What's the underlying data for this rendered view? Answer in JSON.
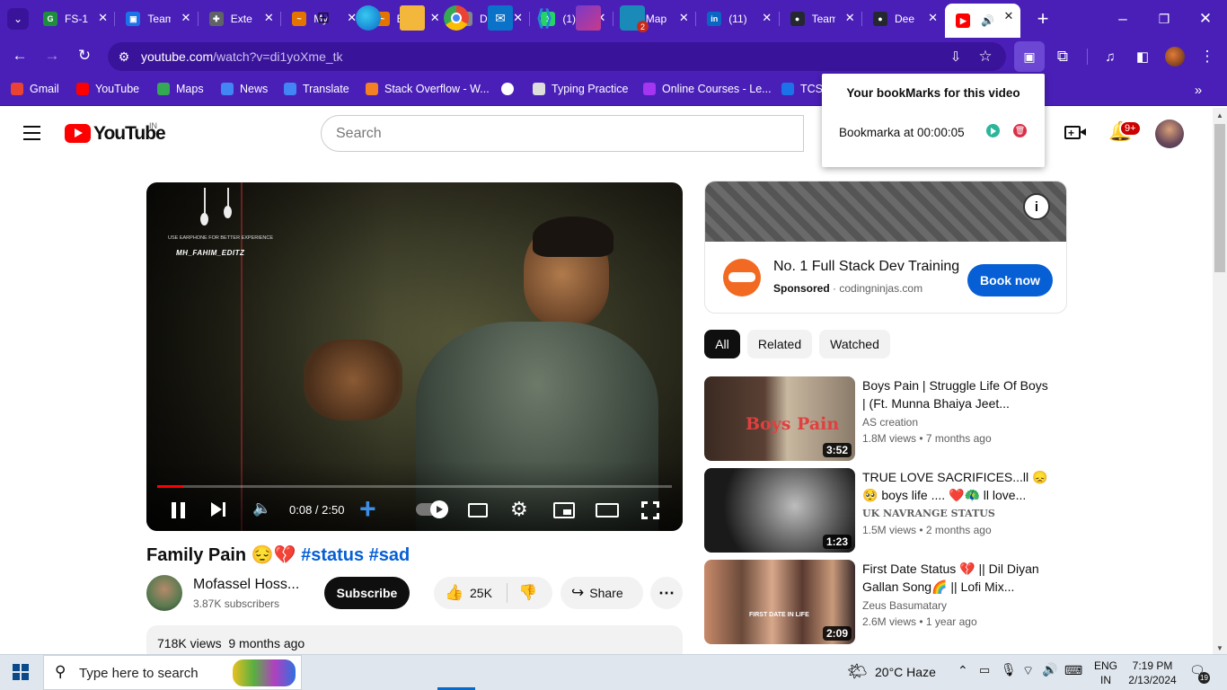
{
  "tabs": [
    {
      "title": "FS-1",
      "color": "#1e8e3e",
      "glyph": "G"
    },
    {
      "title": "Team",
      "color": "#1a73e8",
      "glyph": "▣"
    },
    {
      "title": "Exte",
      "color": "#5f6368",
      "glyph": "✚"
    },
    {
      "title": "My",
      "color": "#e37400",
      "glyph": "~"
    },
    {
      "title": "Butt",
      "color": "#e37400",
      "glyph": "~"
    },
    {
      "title": "Doc",
      "color": "#80868b",
      "glyph": "◐"
    },
    {
      "title": "(1) W",
      "color": "#25d366",
      "glyph": "1"
    },
    {
      "title": "Map",
      "color": "#000000",
      "glyph": "DEV"
    },
    {
      "title": "(11)",
      "color": "#0a66c2",
      "glyph": "in"
    },
    {
      "title": "Team",
      "color": "#24292f",
      "glyph": "●"
    },
    {
      "title": "Dee",
      "color": "#24292f",
      "glyph": "●"
    },
    {
      "title": "",
      "color": "#ff0000",
      "glyph": "▶"
    }
  ],
  "address": {
    "domain": "youtube.com",
    "path": "/watch?v=di1yoXme_tk"
  },
  "bookmarks": [
    {
      "label": "Gmail",
      "color": "#ea4335"
    },
    {
      "label": "YouTube",
      "color": "#ff0000"
    },
    {
      "label": "Maps",
      "color": "#34a853"
    },
    {
      "label": "News",
      "color": "#4285f4"
    },
    {
      "label": "Translate",
      "color": "#4285f4"
    },
    {
      "label": "Stack Overflow - W...",
      "color": "#f48024"
    },
    {
      "label": "",
      "color": "#ffffff"
    },
    {
      "label": "Typing Practice",
      "color": "#dddddd"
    },
    {
      "label": "Online Courses - Le...",
      "color": "#a435f0"
    },
    {
      "label": "TCS",
      "color": "#1a73e8"
    }
  ],
  "popup": {
    "title": "Your bookMarks for this video",
    "items": [
      {
        "label": "Bookmarka at 00:00:05"
      }
    ]
  },
  "yt": {
    "logo": "YouTube",
    "region": "IN",
    "search_placeholder": "Search",
    "notif_count": "9+"
  },
  "player": {
    "watermark_small": "USE EARPHONE FOR BETTER EXPERIENCE",
    "watermark": "MH_FAHIM_EDITZ",
    "time": "0:08 / 2:50",
    "progress": 0.05
  },
  "video": {
    "title": "Family Pain 😔💔",
    "hashtags": "#status #sad",
    "channel": "Mofassel Hoss...",
    "subscribers": "3.87K subscribers",
    "subscribe_label": "Subscribe",
    "likes": "25K",
    "share_label": "Share",
    "views": "718K views",
    "date": "9 months ago"
  },
  "ad": {
    "title": "No. 1 Full Stack Dev Training",
    "sponsored": "Sponsored",
    "domain": "codingninjas.com",
    "cta": "Book now"
  },
  "chips": [
    "All",
    "Related",
    "Watched"
  ],
  "recommendations": [
    {
      "title": "Boys Pain | Struggle Life Of Boys | (Ft. Munna Bhaiya Jeet...",
      "channel": "AS creation",
      "views": "1.8M views",
      "age": "7 months ago",
      "duration": "3:52",
      "thumb_text": "Boys Pain"
    },
    {
      "title": "TRUE LOVE SACRIFICES...ll 😞 🥺 boys life .... ❤️🦚 ll love...",
      "channel": "UK NAVRANGE STATUS",
      "views": "1.5M views",
      "age": "2 months ago",
      "duration": "1:23",
      "thumb_text": ""
    },
    {
      "title": "First Date Status 💔 || Dil Diyan Gallan Song🌈 || Lofi Mix...",
      "channel": "Zeus Basumatary",
      "views": "2.6M views",
      "age": "1 year ago",
      "duration": "2:09",
      "thumb_text": "FIRST DATE IN LIFE"
    }
  ],
  "taskbar": {
    "search_placeholder": "Type here to search",
    "weather": "20°C  Haze",
    "lang1": "ENG",
    "lang2": "IN",
    "time": "7:19 PM",
    "date": "2/13/2024",
    "notif": "19",
    "chrome_badge": "2"
  },
  "colors": {
    "chrome": "#4a1fb8",
    "yt_red": "#ff0000",
    "link": "#065fd4",
    "subscribe": "#0f0f0f",
    "book_now": "#065fd4"
  }
}
